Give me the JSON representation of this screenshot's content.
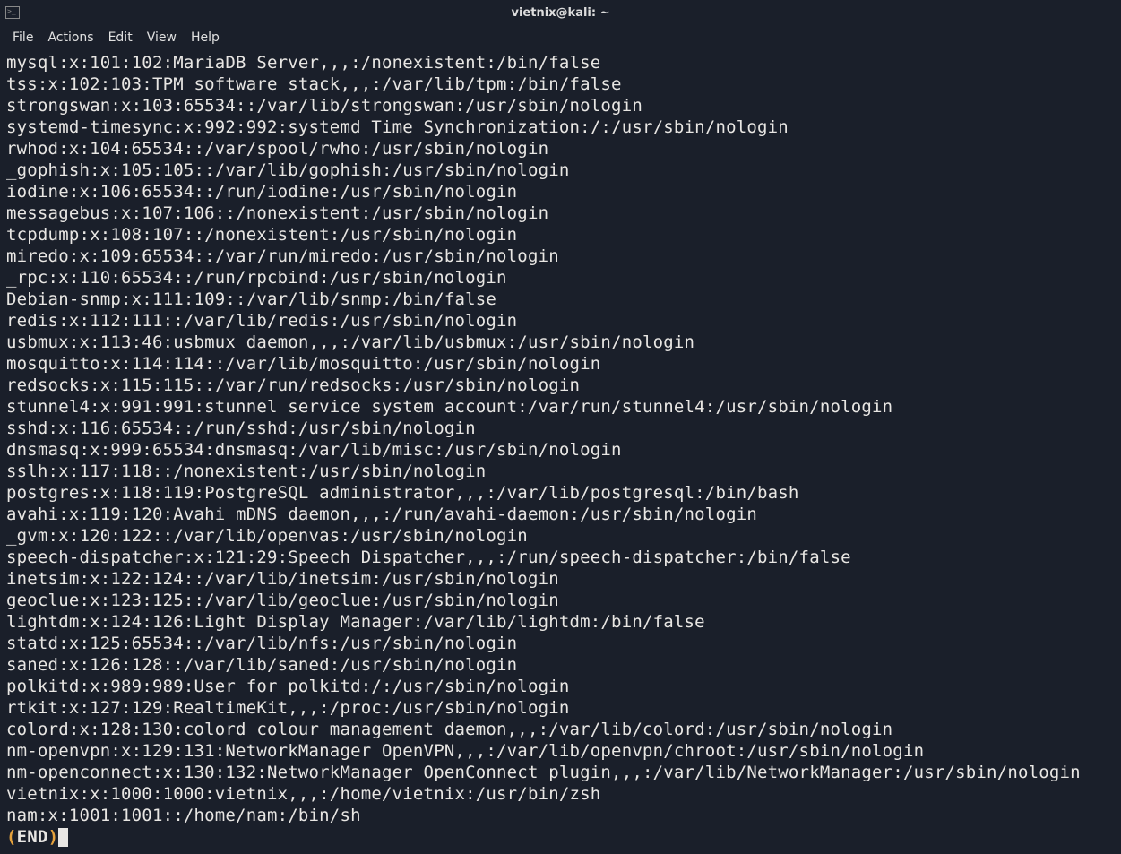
{
  "titlebar": {
    "title": "vietnix@kali: ~"
  },
  "menubar": {
    "items": [
      "File",
      "Actions",
      "Edit",
      "View",
      "Help"
    ]
  },
  "terminal": {
    "lines": [
      "mysql:x:101:102:MariaDB Server,,,:/nonexistent:/bin/false",
      "tss:x:102:103:TPM software stack,,,:/var/lib/tpm:/bin/false",
      "strongswan:x:103:65534::/var/lib/strongswan:/usr/sbin/nologin",
      "systemd-timesync:x:992:992:systemd Time Synchronization:/:/usr/sbin/nologin",
      "rwhod:x:104:65534::/var/spool/rwho:/usr/sbin/nologin",
      "_gophish:x:105:105::/var/lib/gophish:/usr/sbin/nologin",
      "iodine:x:106:65534::/run/iodine:/usr/sbin/nologin",
      "messagebus:x:107:106::/nonexistent:/usr/sbin/nologin",
      "tcpdump:x:108:107::/nonexistent:/usr/sbin/nologin",
      "miredo:x:109:65534::/var/run/miredo:/usr/sbin/nologin",
      "_rpc:x:110:65534::/run/rpcbind:/usr/sbin/nologin",
      "Debian-snmp:x:111:109::/var/lib/snmp:/bin/false",
      "redis:x:112:111::/var/lib/redis:/usr/sbin/nologin",
      "usbmux:x:113:46:usbmux daemon,,,:/var/lib/usbmux:/usr/sbin/nologin",
      "mosquitto:x:114:114::/var/lib/mosquitto:/usr/sbin/nologin",
      "redsocks:x:115:115::/var/run/redsocks:/usr/sbin/nologin",
      "stunnel4:x:991:991:stunnel service system account:/var/run/stunnel4:/usr/sbin/nologin",
      "sshd:x:116:65534::/run/sshd:/usr/sbin/nologin",
      "dnsmasq:x:999:65534:dnsmasq:/var/lib/misc:/usr/sbin/nologin",
      "sslh:x:117:118::/nonexistent:/usr/sbin/nologin",
      "postgres:x:118:119:PostgreSQL administrator,,,:/var/lib/postgresql:/bin/bash",
      "avahi:x:119:120:Avahi mDNS daemon,,,:/run/avahi-daemon:/usr/sbin/nologin",
      "_gvm:x:120:122::/var/lib/openvas:/usr/sbin/nologin",
      "speech-dispatcher:x:121:29:Speech Dispatcher,,,:/run/speech-dispatcher:/bin/false",
      "inetsim:x:122:124::/var/lib/inetsim:/usr/sbin/nologin",
      "geoclue:x:123:125::/var/lib/geoclue:/usr/sbin/nologin",
      "lightdm:x:124:126:Light Display Manager:/var/lib/lightdm:/bin/false",
      "statd:x:125:65534::/var/lib/nfs:/usr/sbin/nologin",
      "saned:x:126:128::/var/lib/saned:/usr/sbin/nologin",
      "polkitd:x:989:989:User for polkitd:/:/usr/sbin/nologin",
      "rtkit:x:127:129:RealtimeKit,,,:/proc:/usr/sbin/nologin",
      "colord:x:128:130:colord colour management daemon,,,:/var/lib/colord:/usr/sbin/nologin",
      "nm-openvpn:x:129:131:NetworkManager OpenVPN,,,:/var/lib/openvpn/chroot:/usr/sbin/nologin",
      "nm-openconnect:x:130:132:NetworkManager OpenConnect plugin,,,:/var/lib/NetworkManager:/usr/sbin/nologin",
      "vietnix:x:1000:1000:vietnix,,,:/home/vietnix:/usr/bin/zsh",
      "nam:x:1001:1001::/home/nam:/bin/sh"
    ],
    "end_open": "(",
    "end_text": "END",
    "end_close": ")"
  }
}
